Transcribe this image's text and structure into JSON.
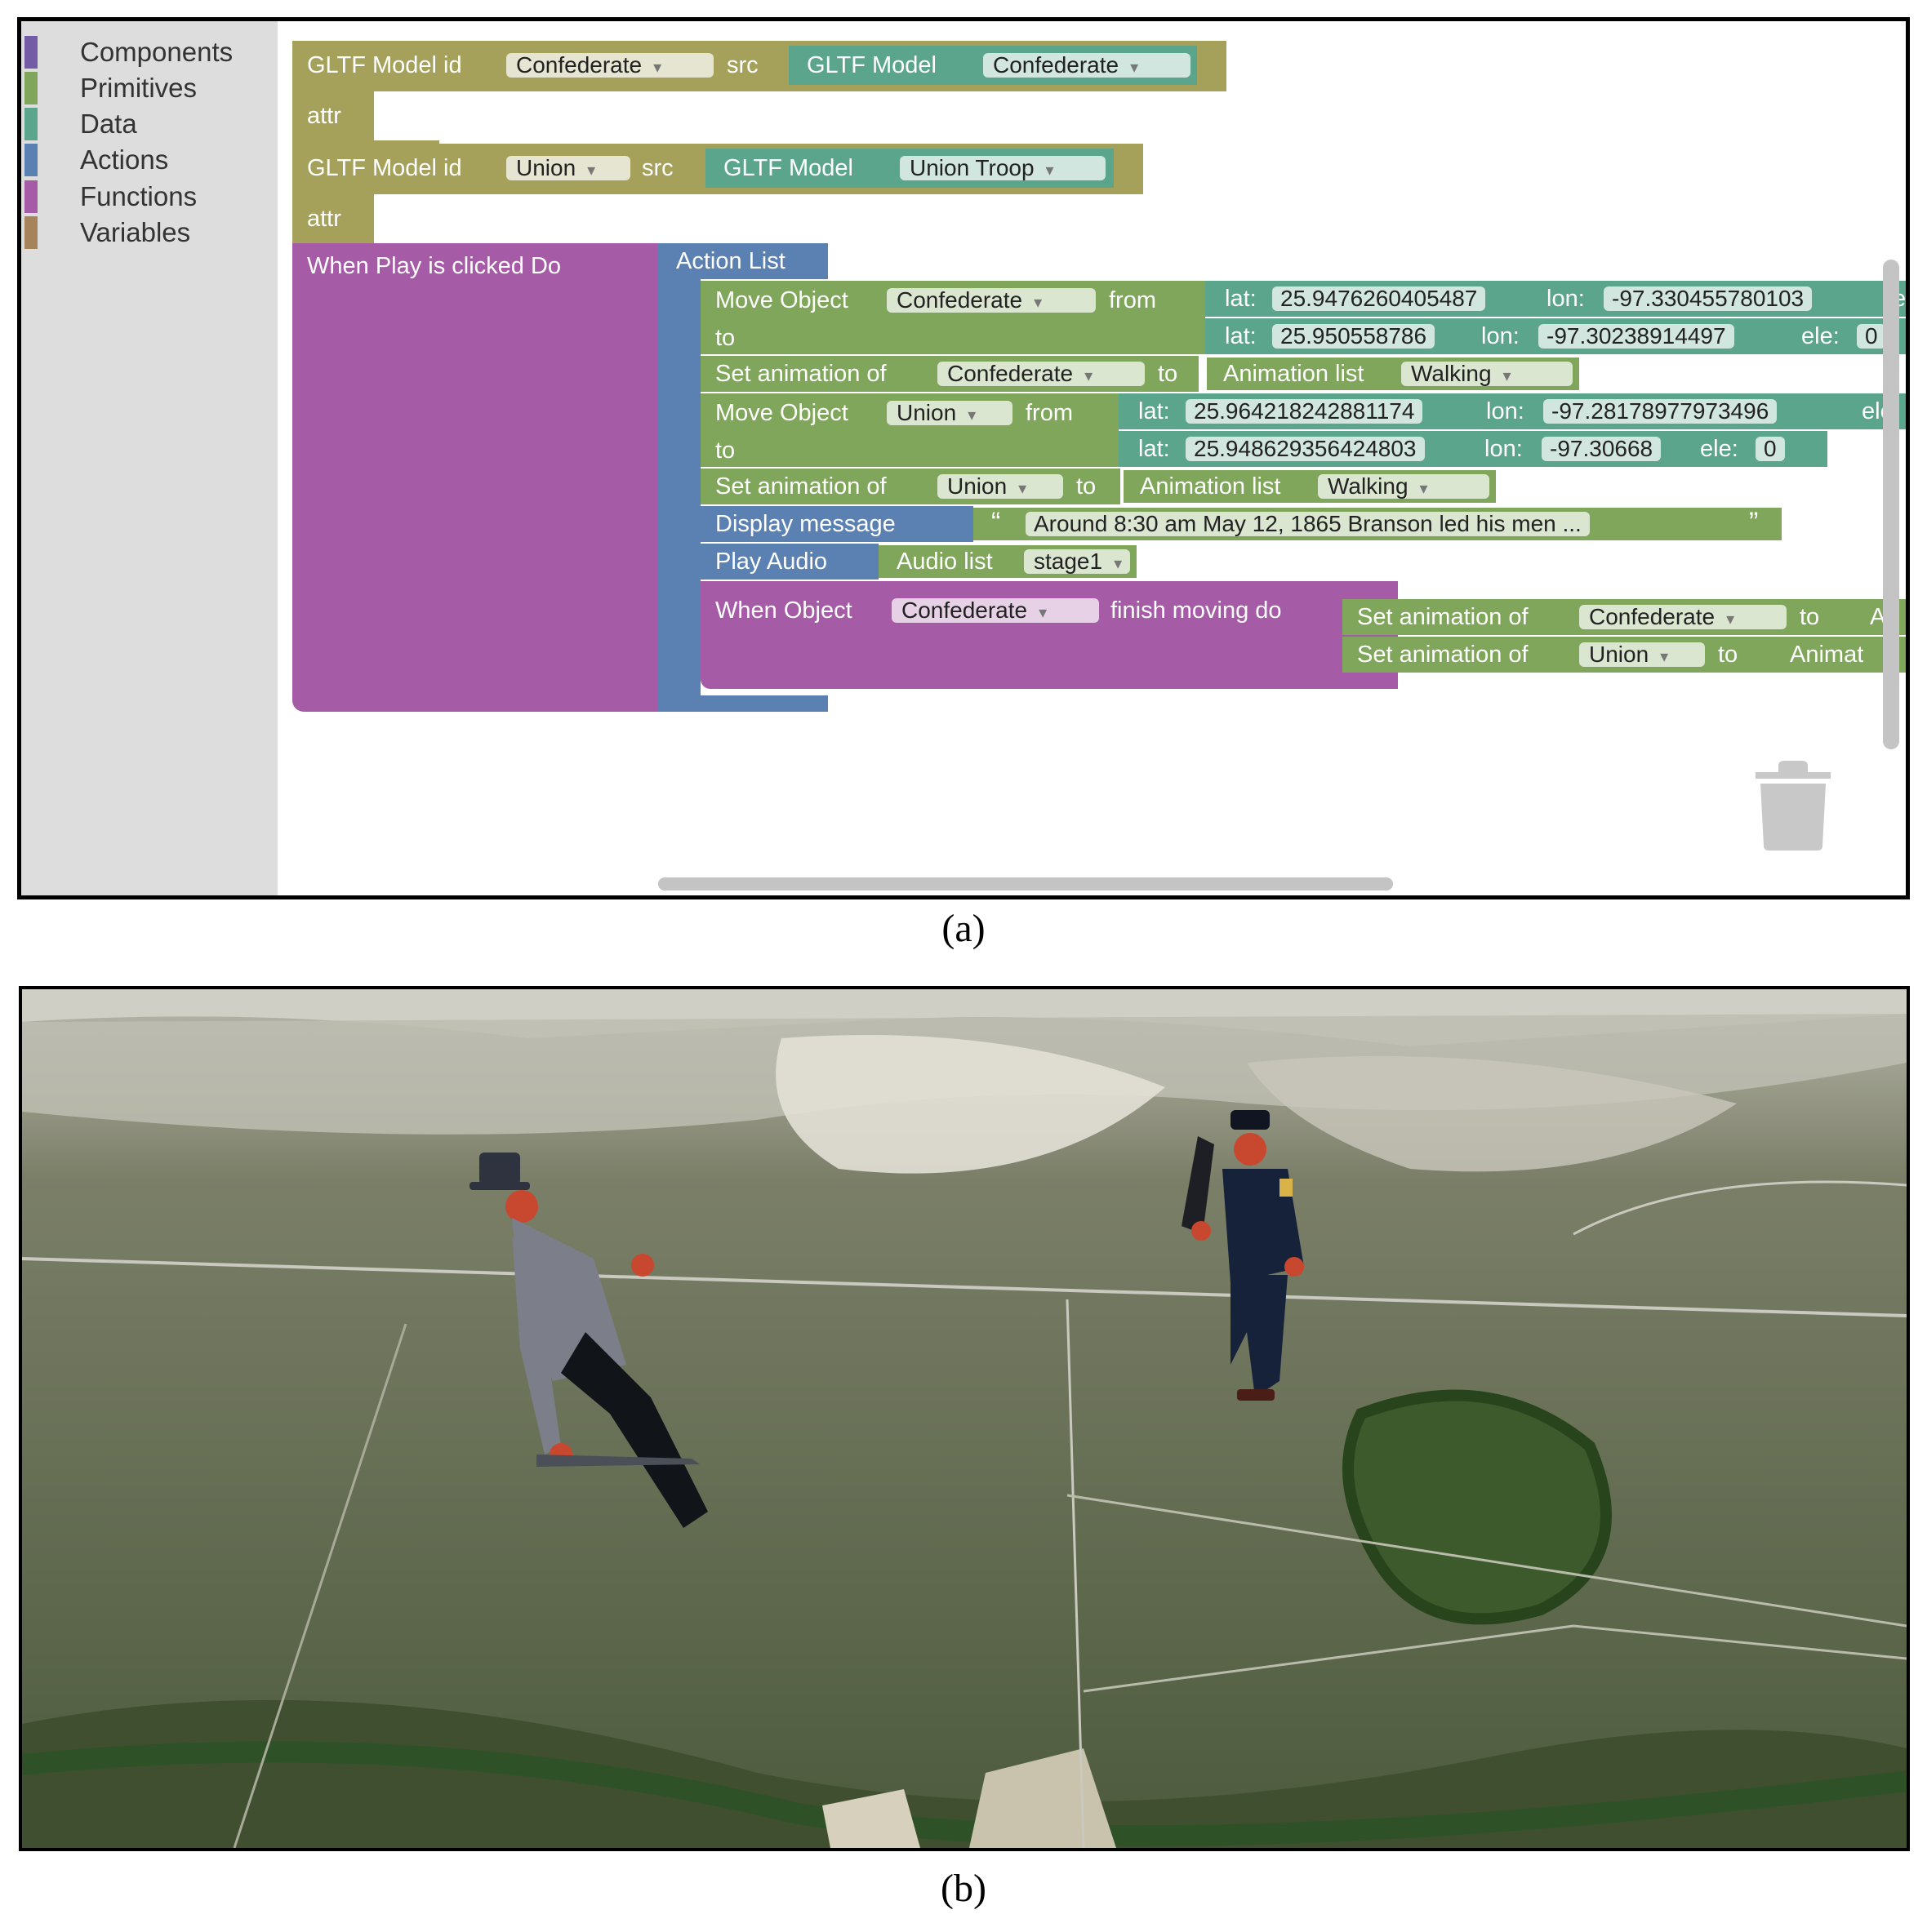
{
  "toolbox": {
    "items": [
      {
        "label": "Components",
        "color": "#745ba5"
      },
      {
        "label": "Primitives",
        "color": "#7fa65a"
      },
      {
        "label": "Data",
        "color": "#5ba58c"
      },
      {
        "label": "Actions",
        "color": "#5b80b2"
      },
      {
        "label": "Functions",
        "color": "#a55ba5"
      },
      {
        "label": "Variables",
        "color": "#a5845b"
      }
    ]
  },
  "blocks": {
    "gltf1": {
      "label": "GLTF Model id",
      "id_value": "Confederate",
      "src": "src",
      "attr": "attr",
      "model_label": "GLTF Model",
      "model_value": "Confederate"
    },
    "gltf2": {
      "label": "GLTF Model id",
      "id_value": "Union",
      "src": "src",
      "attr": "attr",
      "model_label": "GLTF Model",
      "model_value": "Union Troop"
    },
    "event": {
      "label": "When Play is clicked Do",
      "action_list": "Action List"
    },
    "move1": {
      "label": "Move Object",
      "object": "Confederate",
      "from": "from",
      "to": "to",
      "from_lat_label": "lat:",
      "from_lat": "25.9476260405487",
      "from_lon_label": "lon:",
      "from_lon": "-97.330455780103",
      "from_ele_cut": "e",
      "to_lat_label": "lat:",
      "to_lat": "25.950558786",
      "to_lon_label": "lon:",
      "to_lon": "-97.30238914497",
      "to_ele_label": "ele:",
      "to_ele": "0"
    },
    "anim1": {
      "label": "Set animation of",
      "object": "Confederate",
      "to": "to",
      "list_label": "Animation list",
      "list_value": "Walking"
    },
    "move2": {
      "label": "Move Object",
      "object": "Union",
      "from": "from",
      "to": "to",
      "from_lat_label": "lat:",
      "from_lat": "25.964218242881174",
      "from_lon_label": "lon:",
      "from_lon": "-97.28178977973496",
      "from_ele_cut": "ele",
      "to_lat_label": "lat:",
      "to_lat": "25.948629356424803",
      "to_lon_label": "lon:",
      "to_lon": "-97.30668",
      "to_ele_label": "ele:",
      "to_ele": "0"
    },
    "anim2": {
      "label": "Set animation of",
      "object": "Union",
      "to": "to",
      "list_label": "Animation list",
      "list_value": "Walking"
    },
    "display": {
      "label": "Display message",
      "open_quote": "“",
      "message": "Around 8:30 am May 12, 1865 Branson led his men ...",
      "close_quote": "”"
    },
    "audio": {
      "label": "Play Audio",
      "list_label": "Audio list",
      "list_value": "stage1"
    },
    "finish": {
      "label": "When Object",
      "object": "Confederate",
      "label2": "finish moving do",
      "set1_label": "Set animation of",
      "set1_object": "Confederate",
      "set1_to": "to",
      "set1_cut": "A",
      "set2_label": "Set animation of",
      "set2_object": "Union",
      "set2_to": "to",
      "set2_cut": "Animat"
    }
  },
  "captions": {
    "a": "(a)",
    "b": "(b)"
  },
  "colors": {
    "olive": "#a5a15a",
    "light_green": "#7fa65a",
    "teal": "#5ba58c",
    "blue": "#5b80b2",
    "purple": "#a55ba5",
    "toolbox_bg": "#dddddd"
  }
}
